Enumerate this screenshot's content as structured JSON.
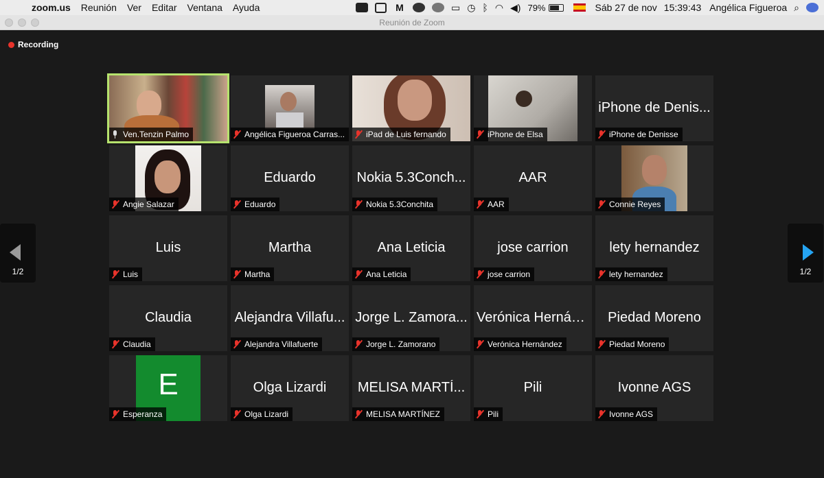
{
  "menubar": {
    "app": "zoom.us",
    "items": [
      "Reunión",
      "Ver",
      "Editar",
      "Ventana",
      "Ayuda"
    ],
    "battery": "79%",
    "battery_level": 0.79,
    "date": "Sáb 27 de nov",
    "time": "15:39:43",
    "user": "Angélica Figueroa"
  },
  "window": {
    "title": "Reunión de Zoom"
  },
  "recording": {
    "label": "Recording"
  },
  "pager": {
    "left": "1/2",
    "right": "1/2"
  },
  "participants": [
    {
      "big": "",
      "label": "Ven.Tenzin Palmo",
      "video": "v1",
      "muted": false,
      "active": true
    },
    {
      "big": "",
      "label": "Angélica Figueroa Carras...",
      "video": "v2",
      "muted": true
    },
    {
      "big": "",
      "label": "iPad de Luis fernando",
      "video": "v3",
      "muted": true
    },
    {
      "big": "",
      "label": "iPhone de Elsa",
      "video": "v4",
      "muted": true
    },
    {
      "big": "iPhone de Denis...",
      "label": "iPhone de Denisse",
      "muted": true
    },
    {
      "big": "",
      "label": "Angie Salazar",
      "video": "v6",
      "muted": true
    },
    {
      "big": "Eduardo",
      "label": "Eduardo",
      "muted": true
    },
    {
      "big": "Nokia 5.3Conch...",
      "label": "Nokia 5.3Conchita",
      "muted": true
    },
    {
      "big": "AAR",
      "label": "AAR",
      "muted": true
    },
    {
      "big": "",
      "label": "Connie Reyes",
      "video": "v10",
      "muted": true
    },
    {
      "big": "Luis",
      "label": "Luis",
      "muted": true
    },
    {
      "big": "Martha",
      "label": "Martha",
      "muted": true
    },
    {
      "big": "Ana Leticia",
      "label": "Ana Leticia",
      "muted": true
    },
    {
      "big": "jose carrion",
      "label": "jose carrion",
      "muted": true
    },
    {
      "big": "lety hernandez",
      "label": "lety hernandez",
      "muted": true
    },
    {
      "big": "Claudia",
      "label": "Claudia",
      "muted": true
    },
    {
      "big": "Alejandra Villafu...",
      "label": "Alejandra Villafuerte",
      "muted": true
    },
    {
      "big": "Jorge L. Zamora...",
      "label": "Jorge L. Zamorano",
      "muted": true
    },
    {
      "big": "Verónica Hernán...",
      "label": "Verónica Hernández",
      "muted": true
    },
    {
      "big": "Piedad Moreno",
      "label": "Piedad Moreno",
      "muted": true
    },
    {
      "big": "",
      "label": "Esperanza",
      "video": "v21",
      "letter": "E",
      "muted": true
    },
    {
      "big": "Olga Lizardi",
      "label": "Olga Lizardi",
      "muted": true
    },
    {
      "big": "MELISA MARTÍ...",
      "label": "MELISA MARTÍNEZ",
      "muted": true
    },
    {
      "big": "Pili",
      "label": "Pili",
      "muted": true
    },
    {
      "big": "Ivonne AGS",
      "label": "Ivonne AGS",
      "muted": true
    }
  ],
  "colors": {
    "active_border": "#b6e36e",
    "muted_mic": "#e8332b",
    "pager_arrow": "#25a4f2"
  }
}
